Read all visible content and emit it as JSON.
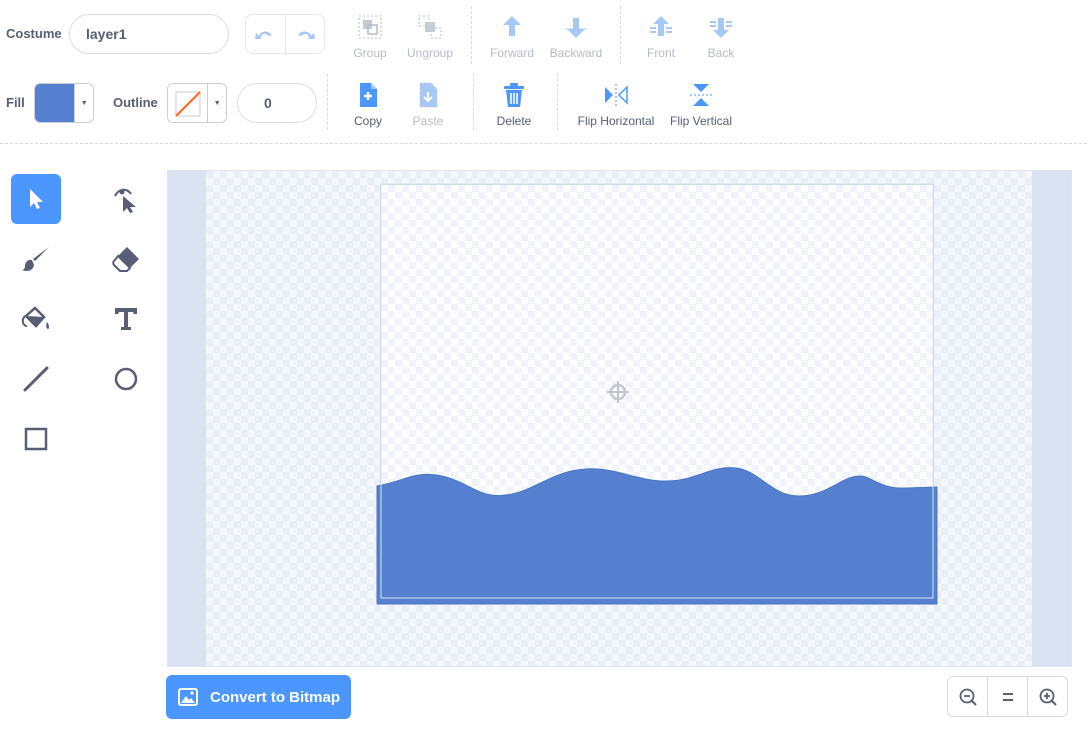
{
  "costume": {
    "label": "Costume",
    "name_value": "layer1"
  },
  "fill": {
    "label": "Fill",
    "color": "#5580cf"
  },
  "outline": {
    "label": "Outline",
    "width_value": "0",
    "color": "none"
  },
  "toolbar": {
    "group": "Group",
    "ungroup": "Ungroup",
    "forward": "Forward",
    "backward": "Backward",
    "front": "Front",
    "back": "Back",
    "copy": "Copy",
    "paste": "Paste",
    "delete": "Delete",
    "flip_horizontal": "Flip Horizontal",
    "flip_vertical": "Flip Vertical"
  },
  "tools": [
    "select-tool",
    "reshape-tool",
    "brush-tool",
    "eraser-tool",
    "fill-tool",
    "text-tool",
    "line-tool",
    "circle-tool",
    "rectangle-tool"
  ],
  "selected_tool": "select-tool",
  "bottom": {
    "convert_label": "Convert to Bitmap"
  },
  "colors": {
    "accent": "#4c97ff",
    "shape_fill": "#5580cf",
    "disabled": "#b5bbc7",
    "text": "#575e75"
  }
}
